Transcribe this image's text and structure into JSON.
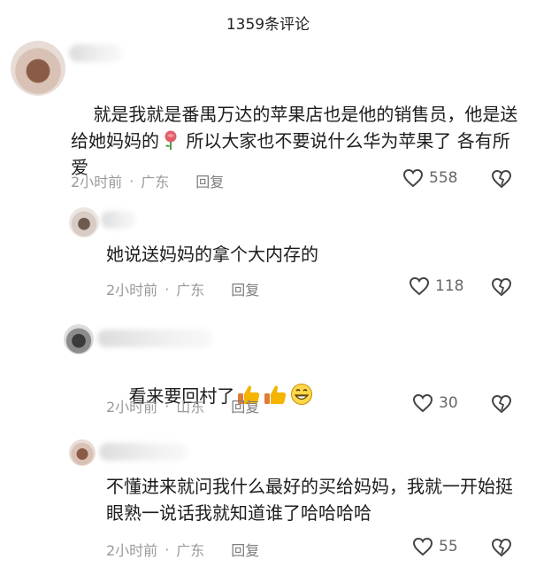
{
  "header": {
    "title": "1359条评论"
  },
  "comments": [
    {
      "text": "就是我就是番禺万达的苹果店也是他的销售员，他是送给她妈妈的",
      "text_after_emoji": " 所以大家也不要说什么华为苹果了 各有所爱",
      "emojis": [
        "rose-emoji"
      ],
      "time": "2小时前",
      "location": "广东",
      "reply": "回复",
      "likes": "558"
    },
    {
      "text": "她说送妈妈的拿个大内存的",
      "time": "2小时前",
      "location": "广东",
      "reply": "回复",
      "likes": "118"
    },
    {
      "text": "看来要回村了",
      "emojis": [
        "thumbs-up-emoji",
        "thumbs-up-emoji",
        "grinning-emoji"
      ],
      "time": "2小时前",
      "location": "山东",
      "reply": "回复",
      "likes": "30"
    },
    {
      "text": "不懂进来就问我什么最好的买给妈妈，我就一开始挺眼熟一说话我就知道谁了哈哈哈哈",
      "time": "2小时前",
      "location": "广东",
      "reply": "回复",
      "likes": "55"
    }
  ],
  "colors": {
    "meta": "#9a9a9a",
    "text": "#1c1c1c",
    "rose": "#e0606a",
    "thumb": "#f4b400"
  }
}
